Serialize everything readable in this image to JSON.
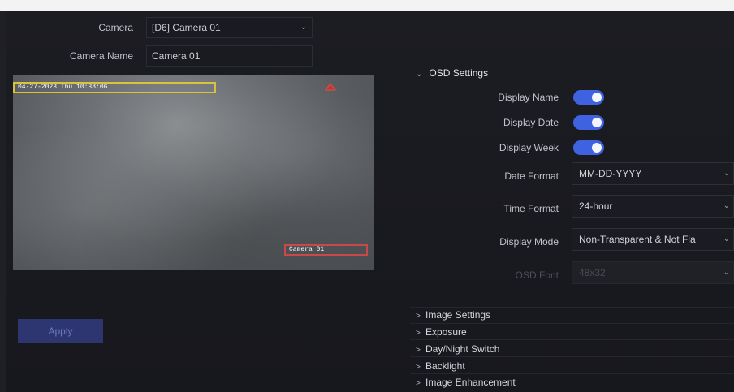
{
  "form": {
    "camera_label": "Camera",
    "camera_value": "[D6] Camera 01",
    "camera_name_label": "Camera Name",
    "camera_name_value": "Camera 01"
  },
  "preview": {
    "osd_date_text": "04-27-2023 Thu 10:38:06",
    "osd_camera_text": "Camera 01"
  },
  "apply_label": "Apply",
  "osd_settings": {
    "title": "OSD Settings",
    "display_name_label": "Display Name",
    "display_name_on": true,
    "display_date_label": "Display Date",
    "display_date_on": true,
    "display_week_label": "Display Week",
    "display_week_on": true,
    "date_format_label": "Date Format",
    "date_format_value": "MM-DD-YYYY",
    "time_format_label": "Time Format",
    "time_format_value": "24-hour",
    "display_mode_label": "Display Mode",
    "display_mode_value": "Non-Transparent & Not Fla",
    "osd_font_label": "OSD Font",
    "osd_font_value": "48x32"
  },
  "sections": [
    {
      "label": "Image Settings"
    },
    {
      "label": "Exposure"
    },
    {
      "label": "Day/Night Switch"
    },
    {
      "label": "Backlight"
    },
    {
      "label": "Image Enhancement"
    }
  ],
  "colors": {
    "accent": "#3f63e0",
    "apply_bg": "#2d3670",
    "osd_date_border": "#d8c43a",
    "osd_name_border": "#c94848"
  },
  "icons": {
    "expand": "chevron-down-icon",
    "collapsed": "chevron-right-icon",
    "dropdown": "chevron-down-icon"
  }
}
